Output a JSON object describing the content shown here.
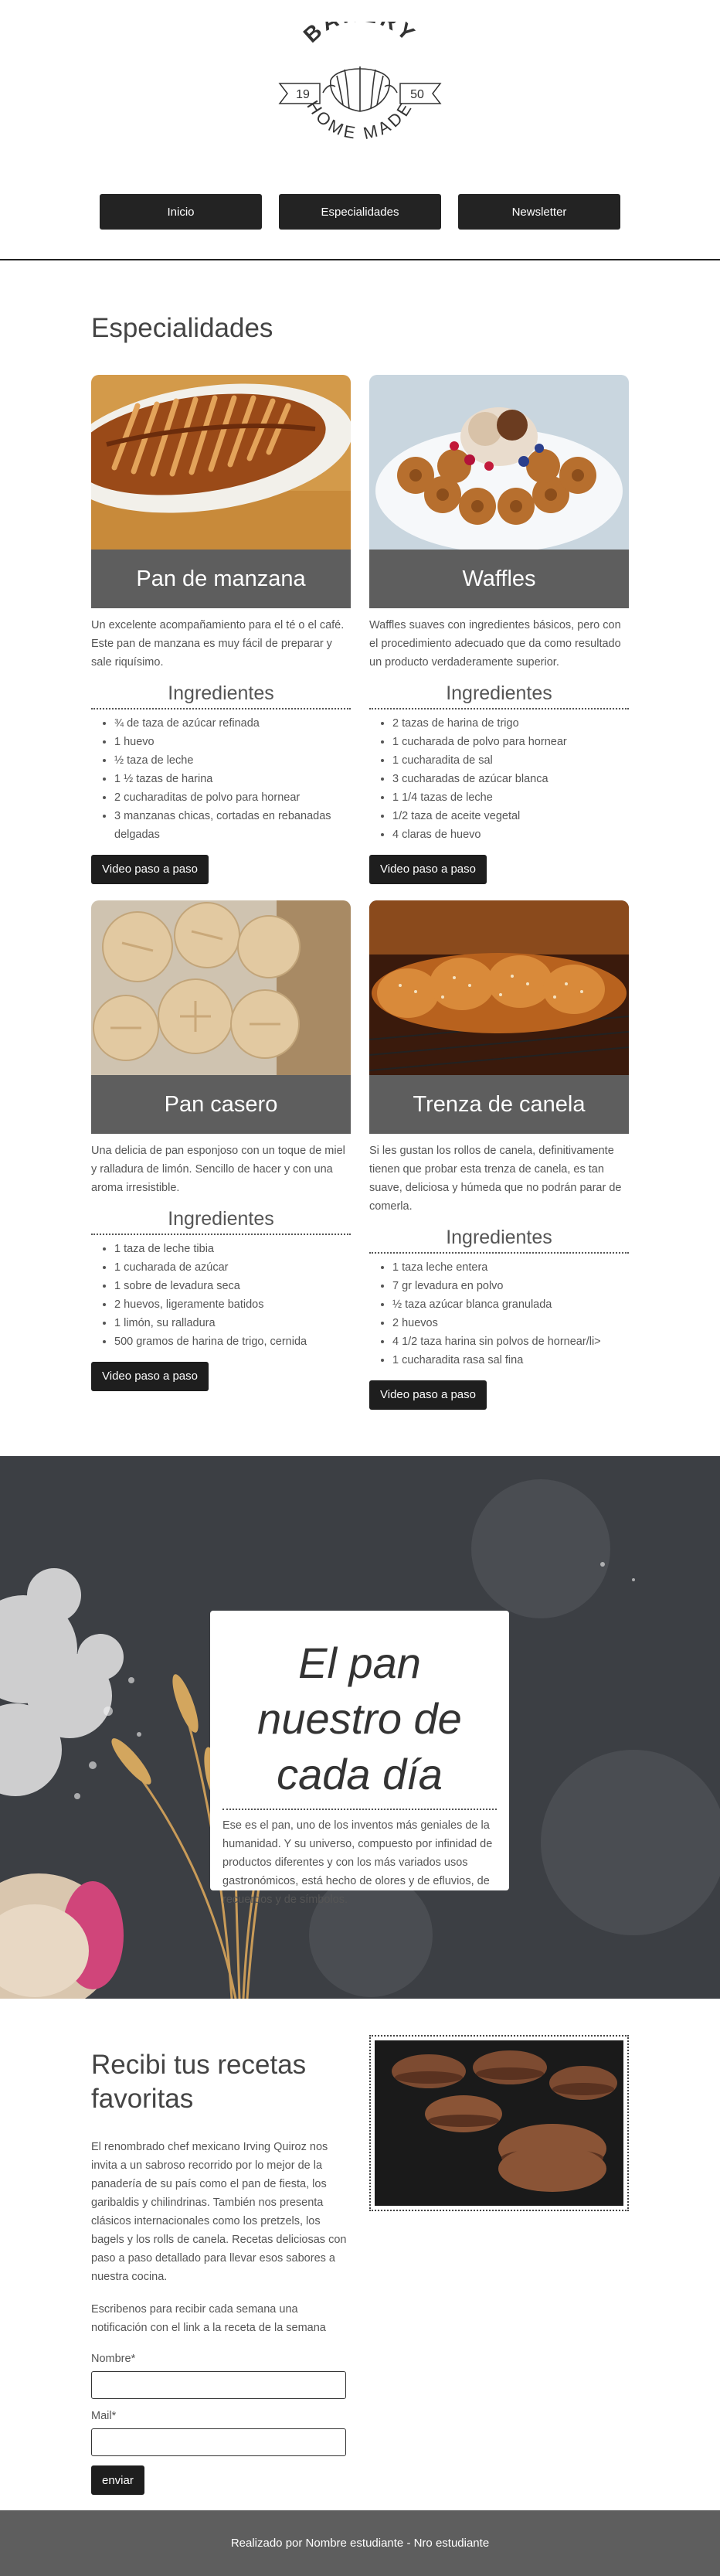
{
  "logo": {
    "top_text": "BAKERY",
    "left_year": "19",
    "right_year": "50",
    "bottom_text": "HOME MADE"
  },
  "nav": [
    {
      "label": "Inicio"
    },
    {
      "label": "Especialidades"
    },
    {
      "label": "Newsletter"
    }
  ],
  "specialties": {
    "title": "Especialidades",
    "ingredients_label": "Ingredientes",
    "video_label": "Video paso a paso",
    "cards": [
      {
        "name": "Pan de manzana",
        "description": "Un excelente acompañamiento para el té o el café. Este pan de manzana es muy fácil de preparar y sale riquísimo.",
        "ingredients": [
          "¾ de taza de azúcar refinada",
          "1 huevo",
          "½ taza de leche",
          "1 ½ tazas de harina",
          "2 cucharaditas de polvo para hornear",
          "3 manzanas chicas, cortadas en rebanadas delgadas"
        ]
      },
      {
        "name": "Waffles",
        "description": "Waffles suaves con ingredientes básicos, pero con el procedimiento adecuado que da como resultado un producto verdaderamente superior.",
        "ingredients": [
          "2 tazas de harina de trigo",
          "1 cucharada de polvo para hornear",
          "1 cucharadita de sal",
          "3 cucharadas de azúcar blanca",
          "1 1/4 tazas de leche",
          "1/2 taza de aceite vegetal",
          "4 claras de huevo"
        ]
      },
      {
        "name": "Pan casero",
        "description": "Una delicia de pan esponjoso con un toque de miel y ralladura de limón. Sencillo de hacer y con una aroma irresistible.",
        "ingredients": [
          "1 taza de leche tibia",
          "1 cucharada de azúcar",
          "1 sobre de levadura seca",
          "2 huevos, ligeramente batidos",
          "1 limón, su ralladura",
          "500 gramos de harina de trigo, cernida"
        ]
      },
      {
        "name": "Trenza de canela",
        "description": "Si les gustan los rollos de canela, definitivamente tienen que probar esta trenza de canela, es tan suave, deliciosa y húmeda que no podrán parar de comerla.",
        "ingredients": [
          "1 taza leche entera",
          "7 gr levadura en polvo",
          "½ taza azúcar blanca granulada",
          "2 huevos",
          "4 1/2 taza harina sin polvos de hornear/li>",
          "1 cucharadita rasa sal fina"
        ]
      }
    ]
  },
  "hero": {
    "title": "El pan nuestro de cada día",
    "text": "Ese es el pan, uno de los inventos más geniales de la humanidad. Y su universo, compuesto por infinidad de productos diferentes y con los más variados usos gastronómicos, está hecho de olores y de efluvios, de recuerdos y de símbolos."
  },
  "newsletter": {
    "title": "Recibi tus recetas favoritas",
    "paragraph1": "El renombrado chef mexicano Irving Quiroz nos invita a un sabroso recorrido por lo mejor de la panadería de su país como el pan de fiesta, los garibaldis y chilindrinas. También nos presenta clásicos internacionales como los pretzels, los bagels y los rolls de canela. Recetas deliciosas con paso a paso detallado para llevar esos sabores a nuestra cocina.",
    "paragraph2": "Escribenos para recibir cada semana una notificación con el link a la receta de la semana",
    "name_label": "Nombre*",
    "mail_label": "Mail*",
    "name_value": "",
    "mail_value": "",
    "submit_label": "enviar"
  },
  "footer": {
    "text": "Realizado por Nombre estudiante - Nro estudiante"
  }
}
